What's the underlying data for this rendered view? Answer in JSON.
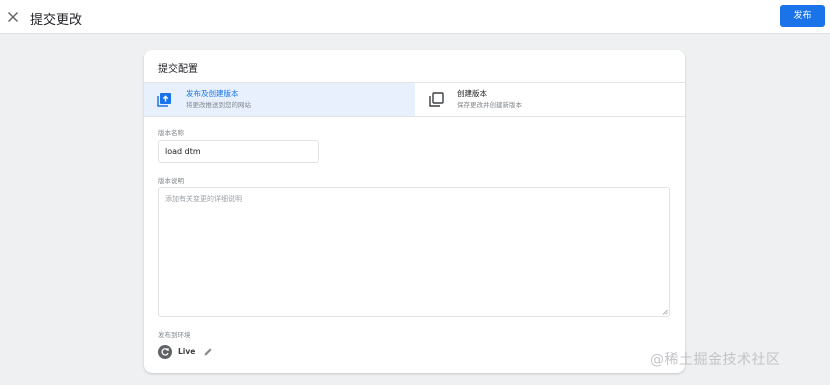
{
  "header": {
    "title": "提交更改",
    "publish_label": "发布"
  },
  "card": {
    "title": "提交配置",
    "options": [
      {
        "label": "发布及创建版本",
        "description": "将更改推送到您的网站"
      },
      {
        "label": "创建版本",
        "description": "保存更改并创建新版本"
      }
    ],
    "version_name": {
      "label": "版本名称",
      "value": "load dtm"
    },
    "version_description": {
      "label": "版本说明",
      "placeholder": "添加有关变更的详细说明"
    },
    "environment": {
      "label": "发布到环境",
      "name": "Live"
    }
  },
  "watermark": "@稀土掘金技术社区",
  "colors": {
    "accent": "#1a73e8",
    "selected_bg": "#e8f0fe",
    "page_bg": "#eff0f2"
  }
}
